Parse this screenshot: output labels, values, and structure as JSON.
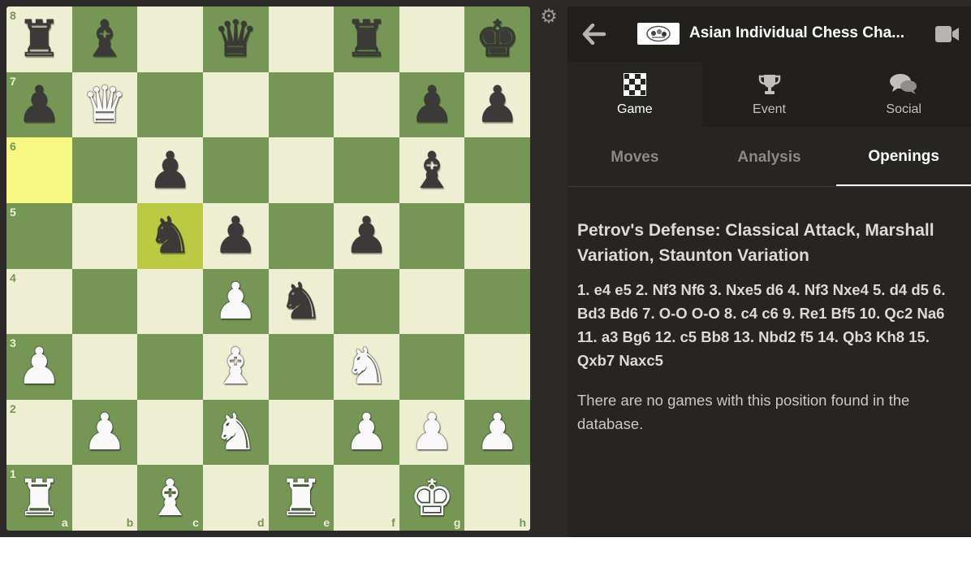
{
  "board": {
    "ranks": [
      "8",
      "7",
      "6",
      "5",
      "4",
      "3",
      "2",
      "1"
    ],
    "files": [
      "a",
      "b",
      "c",
      "d",
      "e",
      "f",
      "g",
      "h"
    ],
    "highlighted_squares": [
      "a6",
      "c5"
    ],
    "pieces": {
      "a8": {
        "color": "b",
        "glyph": "♜",
        "name": "black-rook"
      },
      "b8": {
        "color": "b",
        "glyph": "♝",
        "name": "black-bishop"
      },
      "d8": {
        "color": "b",
        "glyph": "♛",
        "name": "black-queen"
      },
      "f8": {
        "color": "b",
        "glyph": "♜",
        "name": "black-rook"
      },
      "h8": {
        "color": "b",
        "glyph": "♚",
        "name": "black-king"
      },
      "a7": {
        "color": "b",
        "glyph": "♟",
        "name": "black-pawn"
      },
      "b7": {
        "color": "w",
        "glyph": "♛",
        "name": "white-queen"
      },
      "g7": {
        "color": "b",
        "glyph": "♟",
        "name": "black-pawn"
      },
      "h7": {
        "color": "b",
        "glyph": "♟",
        "name": "black-pawn"
      },
      "c6": {
        "color": "b",
        "glyph": "♟",
        "name": "black-pawn"
      },
      "g6": {
        "color": "b",
        "glyph": "♝",
        "name": "black-bishop"
      },
      "c5": {
        "color": "b",
        "glyph": "♞",
        "name": "black-knight"
      },
      "d5": {
        "color": "b",
        "glyph": "♟",
        "name": "black-pawn"
      },
      "f5": {
        "color": "b",
        "glyph": "♟",
        "name": "black-pawn"
      },
      "d4": {
        "color": "w",
        "glyph": "♟",
        "name": "white-pawn"
      },
      "e4": {
        "color": "b",
        "glyph": "♞",
        "name": "black-knight"
      },
      "a3": {
        "color": "w",
        "glyph": "♟",
        "name": "white-pawn"
      },
      "d3": {
        "color": "w",
        "glyph": "♝",
        "name": "white-bishop"
      },
      "f3": {
        "color": "w",
        "glyph": "♞",
        "name": "white-knight"
      },
      "b2": {
        "color": "w",
        "glyph": "♟",
        "name": "white-pawn"
      },
      "d2": {
        "color": "w",
        "glyph": "♞",
        "name": "white-knight"
      },
      "f2": {
        "color": "w",
        "glyph": "♟",
        "name": "white-pawn"
      },
      "g2": {
        "color": "w",
        "glyph": "♟",
        "name": "white-pawn"
      },
      "h2": {
        "color": "w",
        "glyph": "♟",
        "name": "white-pawn"
      },
      "a1": {
        "color": "w",
        "glyph": "♜",
        "name": "white-rook"
      },
      "c1": {
        "color": "w",
        "glyph": "♝",
        "name": "white-bishop"
      },
      "e1": {
        "color": "w",
        "glyph": "♜",
        "name": "white-rook"
      },
      "g1": {
        "color": "w",
        "glyph": "♚",
        "name": "white-king"
      }
    },
    "colors": {
      "light": "#eeeed2",
      "dark": "#769656",
      "highlight_light": "#f6f682",
      "highlight_dark": "#baca44"
    }
  },
  "header": {
    "back_icon": "arrow-left-icon",
    "event_title": "Asian Individual Chess Cha...",
    "camera_icon": "video-camera-icon",
    "settings_icon": "gear-icon"
  },
  "main_tabs": [
    {
      "label": "Game",
      "icon": "chessboard-icon",
      "active": true
    },
    {
      "label": "Event",
      "icon": "trophy-icon",
      "active": false
    },
    {
      "label": "Social",
      "icon": "chat-bubbles-icon",
      "active": false
    }
  ],
  "sub_tabs": [
    {
      "label": "Moves",
      "active": false
    },
    {
      "label": "Analysis",
      "active": false
    },
    {
      "label": "Openings",
      "active": true
    }
  ],
  "openings": {
    "name": "Petrov's Defense: Classical Attack, Marshall Variation, Staunton Variation",
    "moves": "1. e4 e5 2. Nf3 Nf6 3. Nxe5 d6 4. Nf3 Nxe4 5. d4 d5 6. Bd3 Bd6 7. O-O O-O 8. c4 c6 9. Re1 Bf5 10. Qc2 Na6 11. a3 Bg6 12. c5 Bb8 13. Nbd2 f5 14. Qb3 Kh8 15. Qxb7 Naxc5",
    "no_games_message": "There are no games with this position found in the database."
  }
}
